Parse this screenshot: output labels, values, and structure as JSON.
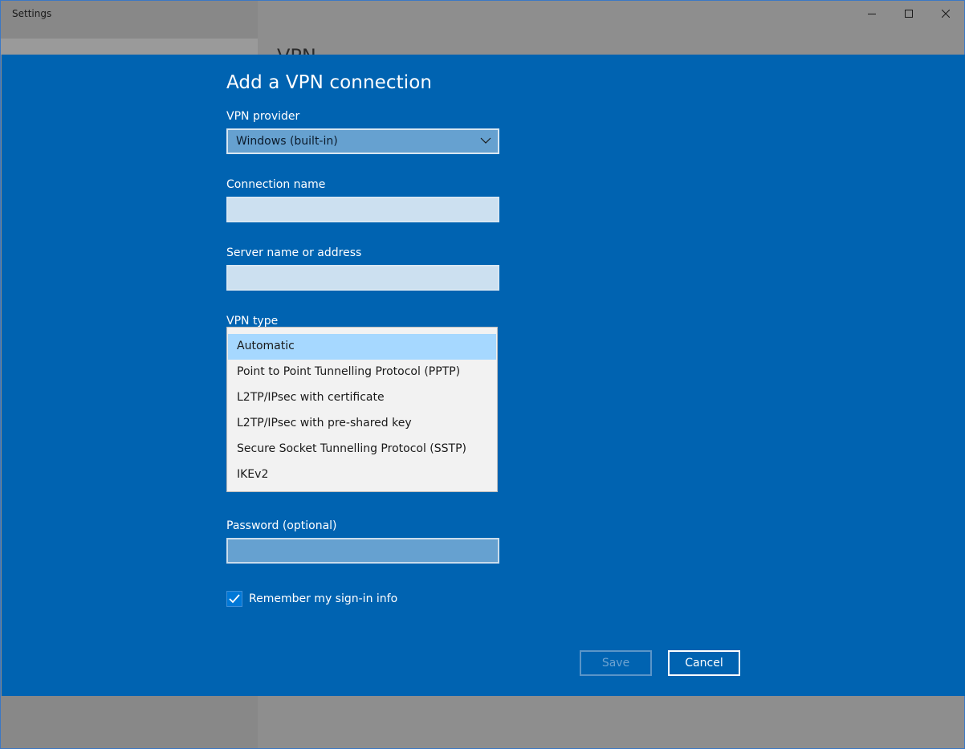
{
  "window": {
    "title": "Settings",
    "page_heading": "VPN",
    "controls": {
      "minimize": "minimize-icon",
      "maximize": "maximize-icon",
      "close": "close-icon"
    }
  },
  "dialog": {
    "title": "Add a VPN connection",
    "vpn_provider": {
      "label": "VPN provider",
      "value": "Windows (built-in)"
    },
    "connection_name": {
      "label": "Connection name",
      "value": ""
    },
    "server": {
      "label": "Server name or address",
      "value": ""
    },
    "vpn_type": {
      "label": "VPN type",
      "selected": "Automatic",
      "options": [
        "Automatic",
        "Point to Point Tunnelling Protocol (PPTP)",
        "L2TP/IPsec with certificate",
        "L2TP/IPsec with pre-shared key",
        "Secure Socket Tunnelling Protocol (SSTP)",
        "IKEv2"
      ]
    },
    "password": {
      "label": "Password (optional)",
      "value": ""
    },
    "remember": {
      "label": "Remember my sign-in info",
      "checked": true
    },
    "buttons": {
      "save": "Save",
      "cancel": "Cancel"
    }
  },
  "colors": {
    "dialog_bg": "#0063b1",
    "accent": "#0078d7",
    "dropdown_highlight": "#a6d8ff"
  }
}
